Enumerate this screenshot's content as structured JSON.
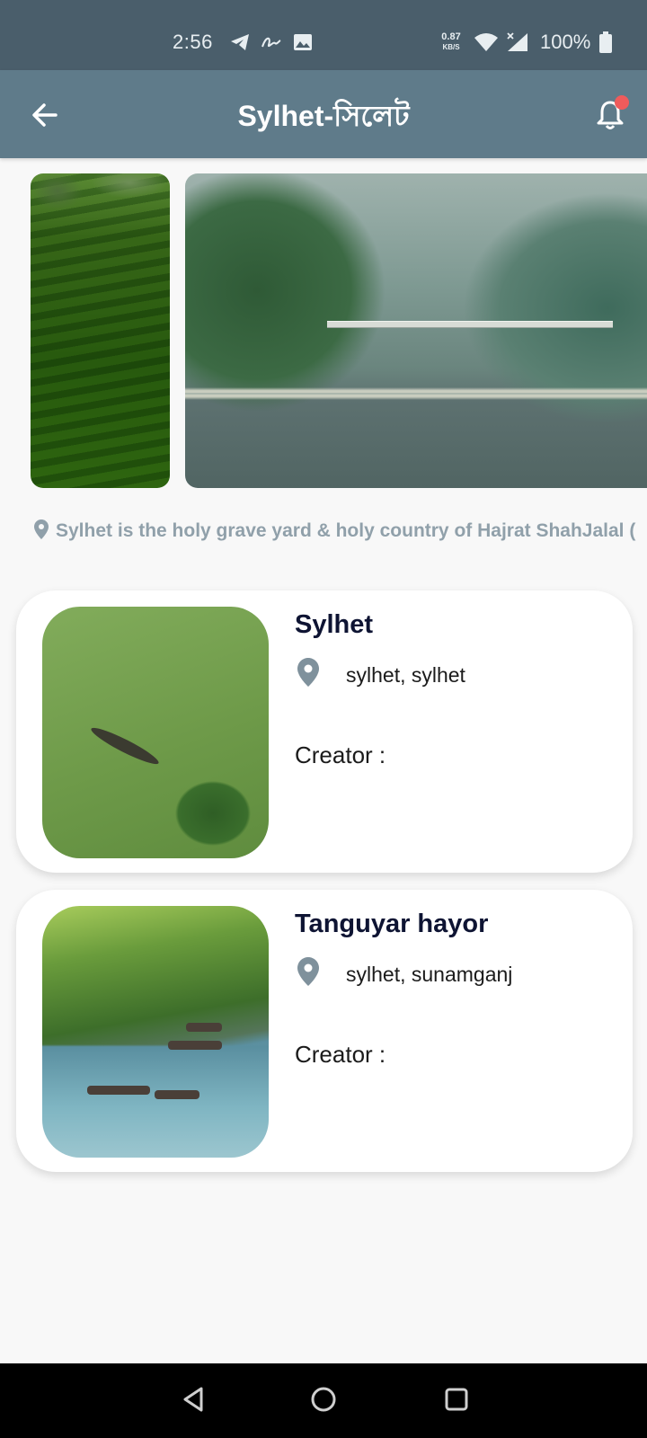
{
  "status_bar": {
    "time": "2:56",
    "net_speed": "0.87",
    "net_unit": "KB/S",
    "battery": "100%",
    "icons": [
      "telegram-icon",
      "signature-app-icon",
      "gallery-icon",
      "wifi-icon",
      "cell-signal-icon",
      "battery-icon"
    ]
  },
  "app_bar": {
    "title": "Sylhet-সিলেট",
    "back_icon": "arrow-left-icon",
    "notification_icon": "bell-icon",
    "badge_color": "#ef5b5b"
  },
  "carousel": {
    "slides": [
      {
        "image": "tea-garden-photo"
      },
      {
        "image": "river-bridge-photo"
      }
    ]
  },
  "caption": {
    "icon": "location-pin-icon",
    "text": "Sylhet is the holy grave yard & holy country of Hajrat ShahJalal ("
  },
  "places": [
    {
      "name": "Sylhet",
      "location": "sylhet, sylhet",
      "creator_label": "Creator :",
      "image": "green-lake-boat-photo"
    },
    {
      "name": "Tanguyar hayor",
      "location": "sylhet, sunamganj",
      "creator_label": "Creator :",
      "image": "haor-boats-photo"
    }
  ],
  "nav_bar": {
    "buttons": [
      "back-triangle-icon",
      "home-circle-icon",
      "recents-square-icon"
    ]
  },
  "colors": {
    "status_bar": "#4a5e6b",
    "app_bar": "#5f7b8a",
    "title_text": "#0e1433",
    "caption_text": "#90a0aa"
  }
}
